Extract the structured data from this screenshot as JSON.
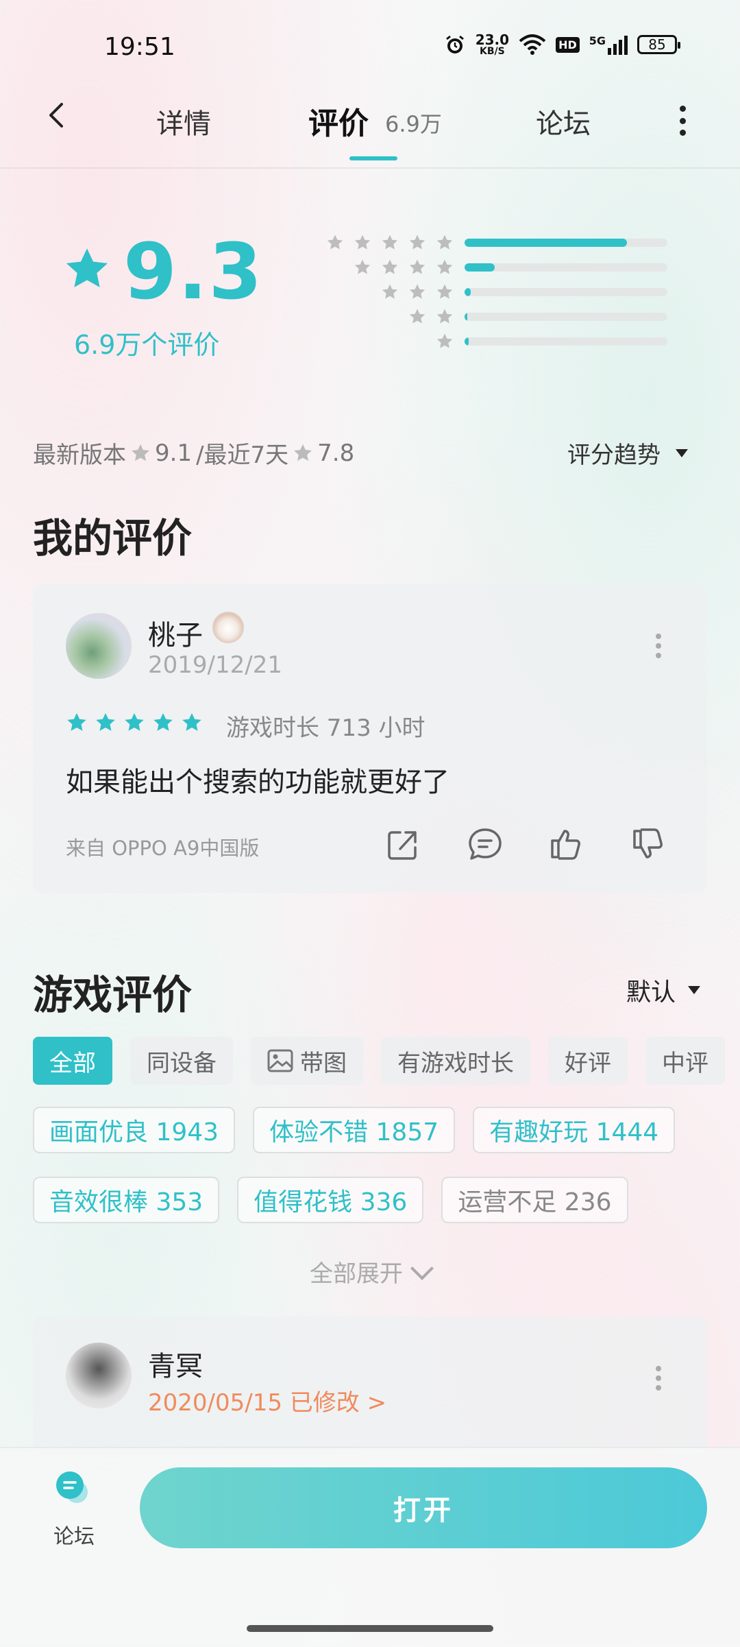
{
  "status": {
    "time": "19:51",
    "net_speed_value": "23.0",
    "net_speed_unit": "KB/S",
    "hd": "HD",
    "signal": "5G",
    "battery": "85"
  },
  "nav": {
    "tabs": [
      {
        "label": "详情"
      },
      {
        "label": "评价",
        "count": "6.9万"
      },
      {
        "label": "论坛"
      }
    ]
  },
  "rating": {
    "score": "9.3",
    "count_text": "6.9万个评价",
    "distribution": [
      {
        "stars": 5,
        "fraction": 0.8
      },
      {
        "stars": 4,
        "fraction": 0.15
      },
      {
        "stars": 3,
        "fraction": 0.03
      },
      {
        "stars": 2,
        "fraction": 0.01
      },
      {
        "stars": 1,
        "fraction": 0.02
      }
    ],
    "latest_version_label": "最新版本",
    "latest_version_score": "9.1",
    "recent_label": "/最近7天",
    "recent_score": "7.8",
    "trend_label": "评分趋势"
  },
  "my_review": {
    "section_title": "我的评价",
    "username": "桃子",
    "date": "2019/12/21",
    "stars": 5,
    "playtime": "游戏时长 713 小时",
    "text": "如果能出个搜索的功能就更好了",
    "device": "来自 OPPO A9中国版"
  },
  "game_reviews": {
    "section_title": "游戏评价",
    "sort_label": "默认",
    "filters": [
      "全部",
      "同设备",
      "带图",
      "有游戏时长",
      "好评",
      "中评"
    ],
    "tags_row1": [
      "画面优良 1943",
      "体验不错 1857",
      "有趣好玩 1444"
    ],
    "tags_row2": [
      "音效很棒 353",
      "值得花钱 336",
      "运营不足 236"
    ],
    "expand_label": "全部展开",
    "first_review": {
      "username": "青冥",
      "date": "2020/05/15 已修改 >"
    }
  },
  "bottom": {
    "forum_label": "论坛",
    "open_button": "打开"
  },
  "colors": {
    "accent": "#2fc0c8",
    "modified_date": "#f08a5d"
  }
}
